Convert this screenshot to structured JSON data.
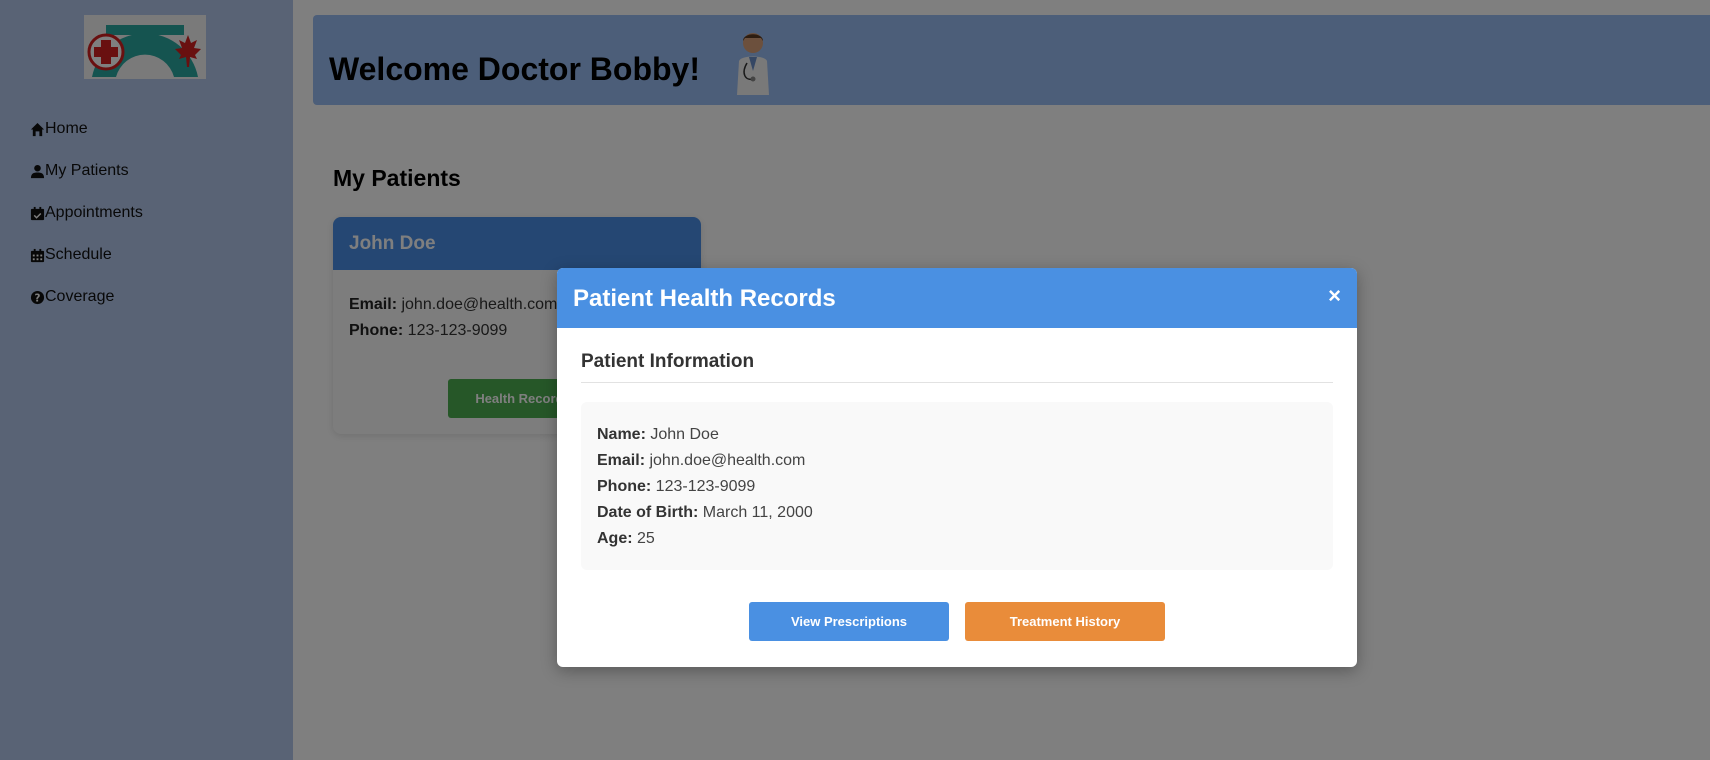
{
  "sidebar": {
    "logo_alt": "Canadian health logo",
    "items": [
      {
        "label": "Home",
        "icon": "home-icon"
      },
      {
        "label": "My Patients",
        "icon": "user-icon"
      },
      {
        "label": "Appointments",
        "icon": "calendar-check-icon"
      },
      {
        "label": "Schedule",
        "icon": "calendar-icon"
      },
      {
        "label": "Coverage",
        "icon": "question-circle-icon"
      }
    ]
  },
  "header": {
    "title": "Welcome Doctor Bobby!"
  },
  "main": {
    "section_title": "My Patients",
    "patient_card": {
      "name": "John Doe",
      "email_label": "Email:",
      "email": "john.doe@health.com",
      "phone_label": "Phone:",
      "phone": "123-123-9099",
      "button_label": "Health Records"
    }
  },
  "modal": {
    "title": "Patient Health Records",
    "close_label": "×",
    "section_heading": "Patient Information",
    "fields": [
      {
        "label": "Name:",
        "value": "John Doe"
      },
      {
        "label": "Email:",
        "value": "john.doe@health.com"
      },
      {
        "label": "Phone:",
        "value": "123-123-9099"
      },
      {
        "label": "Date of Birth:",
        "value": "March 11, 2000"
      },
      {
        "label": "Age:",
        "value": "25"
      }
    ],
    "buttons": {
      "prescriptions": "View Prescriptions",
      "treatment": "Treatment History"
    }
  },
  "colors": {
    "sidebar_bg": "#b3c7ea",
    "header_bg": "#98bdf2",
    "modal_header": "#4a90e2",
    "green_button": "#4caf50",
    "orange_button": "#e98c3a"
  }
}
